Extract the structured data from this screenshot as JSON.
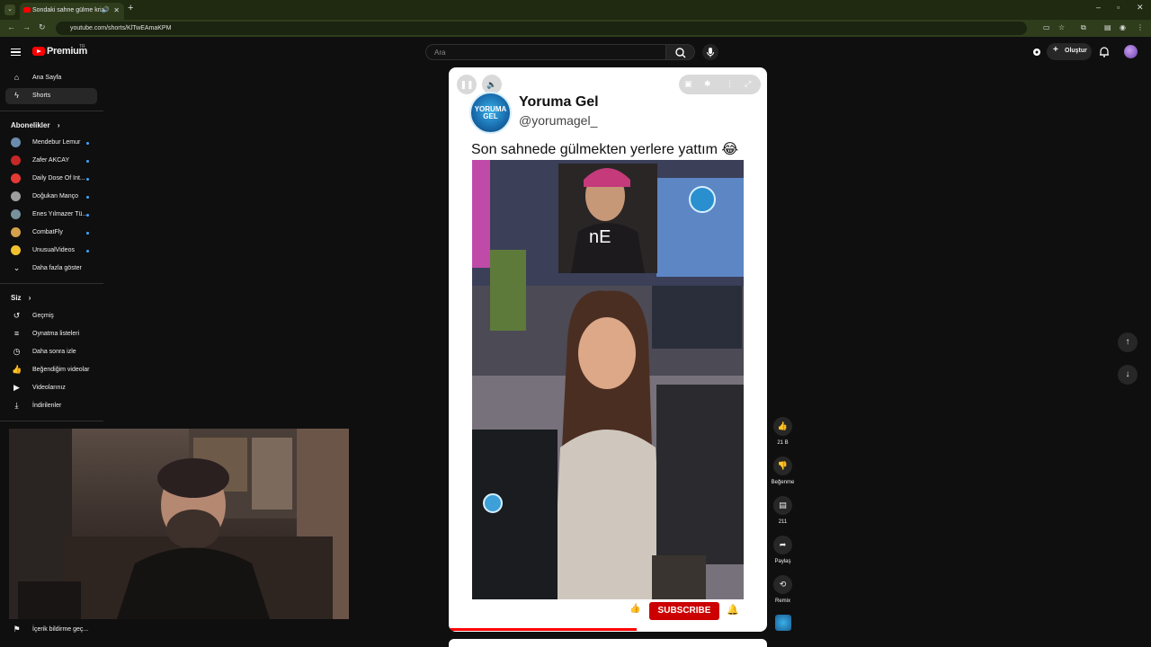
{
  "browser": {
    "tab_title": "Sondaki sahne gülme kriz",
    "url": "youtube.com/shorts/KlTwEAmaKPM"
  },
  "header": {
    "brand": "Premium",
    "region": "TR",
    "search_placeholder": "Ara",
    "create_label": "Oluştur"
  },
  "sidebar": {
    "main_items": [
      {
        "label": "Ana Sayfa",
        "icon": "home-icon"
      },
      {
        "label": "Shorts",
        "icon": "shorts-icon"
      }
    ],
    "subscriptions_heading": "Abonelikler",
    "subscriptions": [
      {
        "label": "Mendebur Lemur"
      },
      {
        "label": "Zafer AKCAY"
      },
      {
        "label": "Daily Dose Of Int..."
      },
      {
        "label": "Doğukan Manço"
      },
      {
        "label": "Enes Yılmazer Tü..."
      },
      {
        "label": "CombatFly"
      },
      {
        "label": "UnusualVideos"
      }
    ],
    "show_more": "Daha fazla göster",
    "you_heading": "Siz",
    "you_items": [
      {
        "label": "Geçmiş",
        "icon": "history-icon"
      },
      {
        "label": "Oynatma listeleri",
        "icon": "playlist-icon"
      },
      {
        "label": "Daha sonra izle",
        "icon": "watch-later-icon"
      },
      {
        "label": "Beğendiğim videolar",
        "icon": "like-icon"
      },
      {
        "label": "Videolarınız",
        "icon": "your-videos-icon"
      },
      {
        "label": "İndirilenler",
        "icon": "download-icon"
      }
    ],
    "bottom_item": "İçerik bildirme geç..."
  },
  "short": {
    "channel_name": "Yoruma Gel",
    "channel_handle": "@yorumagel_",
    "logo_text": "YORUMA GEL",
    "caption": "Son sahnede gülmekten yerlere yattım 😂",
    "overlay_text": "nE",
    "subscribe": "SUBSCRIBE",
    "progress": 0.59
  },
  "actions": {
    "like_count": "21 B",
    "dislike_label": "Beğenme",
    "comment_count": "211",
    "share_label": "Paylaş",
    "remix_label": "Remix"
  }
}
